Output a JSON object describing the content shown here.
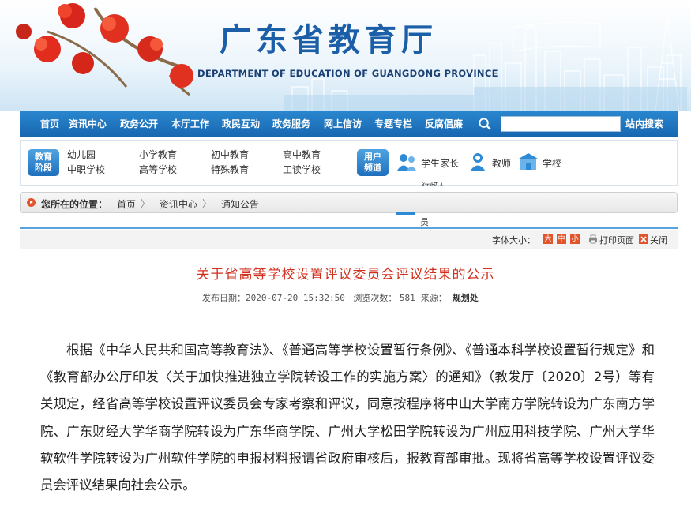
{
  "header": {
    "title": "广东省教育厅",
    "subtitle": "DEPARTMENT OF EDUCATION OF GUANGDONG PROVINCE"
  },
  "nav": {
    "items": [
      "首页",
      "资讯中心",
      "政务公开",
      "本厅工作",
      "政民互动",
      "政务服务",
      "网上信访",
      "专题专栏",
      "反腐倡廉"
    ],
    "search_placeholder": "",
    "search_button": "站内搜索"
  },
  "categories": {
    "stage_badge": [
      "教育",
      "阶段"
    ],
    "stage_links": [
      "幼儿园",
      "中职学校",
      "小学教育",
      "高等学校",
      "初中教育",
      "特殊教育",
      "高中教育",
      "工读学校"
    ],
    "user_badge": [
      "用户",
      "频道"
    ],
    "user_channels": [
      "学生家长",
      "教师",
      "学校"
    ],
    "overflow_a": "行政人",
    "overflow_b": "员"
  },
  "breadcrumb": {
    "label": "您所在的位置：",
    "items": [
      "首页",
      "资讯中心",
      "通知公告"
    ],
    "separator": "〉"
  },
  "tools": {
    "font_size_label": "字体大小：",
    "font_sizes": [
      "大",
      "中",
      "小"
    ],
    "print": "打印页面",
    "close": "关闭"
  },
  "article": {
    "title": "关于省高等学校设置评议委员会评议结果的公示",
    "date_label": "发布日期：",
    "date": "2020-07-20 15:32:50",
    "views_label": "浏览次数：",
    "views": "581",
    "source_label": "来源：",
    "source": "规划处",
    "body": "根据《中华人民共和国高等教育法》、《普通高等学校设置暂行条例》、《普通本科学校设置暂行规定》和《教育部办公厅印发〈关于加快推进独立学院转设工作的实施方案〉的通知》（教发厅〔2020〕2号）等有关规定，经省高等学校设置评议委员会专家考察和评议，同意按程序将中山大学南方学院转设为广东南方学院、广东财经大学华商学院转设为广东华商学院、广州大学松田学院转设为广州应用科技学院、广州大学华软软件学院转设为广州软件学院的申报材料报请省政府审核后，报教育部审批。现将省高等学校设置评议委员会评议结果向社会公示。"
  },
  "colors": {
    "nav_blue": "#1766b0",
    "title_red": "#d2301e",
    "brand_blue": "#1b5fa8"
  }
}
